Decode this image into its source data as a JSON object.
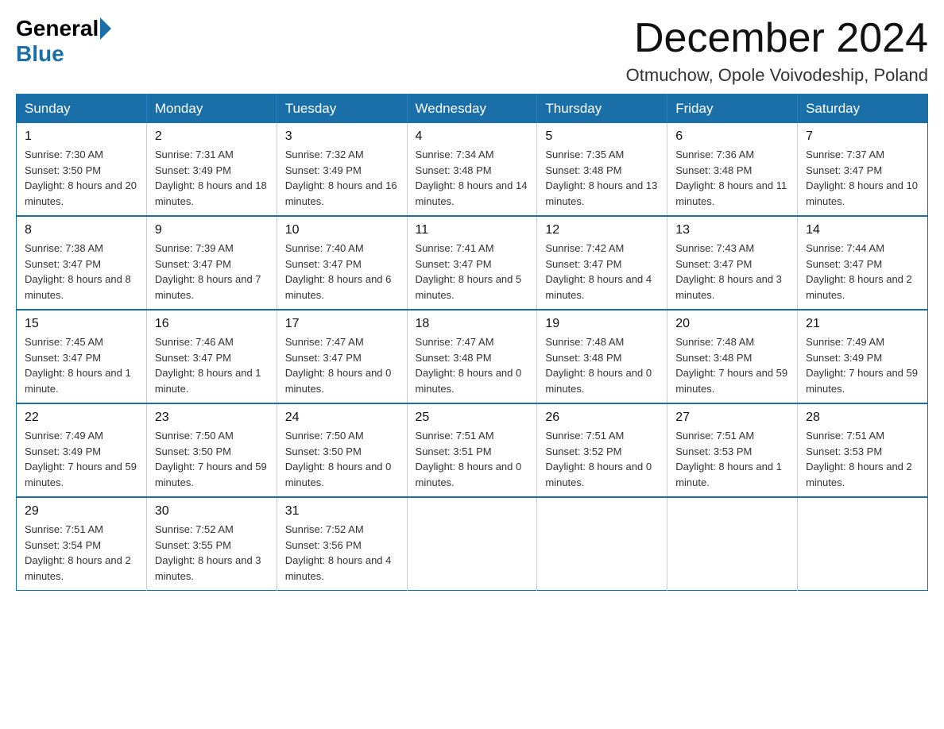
{
  "logo": {
    "general": "General",
    "blue": "Blue"
  },
  "title": "December 2024",
  "location": "Otmuchow, Opole Voivodeship, Poland",
  "days_of_week": [
    "Sunday",
    "Monday",
    "Tuesday",
    "Wednesday",
    "Thursday",
    "Friday",
    "Saturday"
  ],
  "weeks": [
    [
      {
        "day": "1",
        "sunrise": "7:30 AM",
        "sunset": "3:50 PM",
        "daylight": "8 hours and 20 minutes."
      },
      {
        "day": "2",
        "sunrise": "7:31 AM",
        "sunset": "3:49 PM",
        "daylight": "8 hours and 18 minutes."
      },
      {
        "day": "3",
        "sunrise": "7:32 AM",
        "sunset": "3:49 PM",
        "daylight": "8 hours and 16 minutes."
      },
      {
        "day": "4",
        "sunrise": "7:34 AM",
        "sunset": "3:48 PM",
        "daylight": "8 hours and 14 minutes."
      },
      {
        "day": "5",
        "sunrise": "7:35 AM",
        "sunset": "3:48 PM",
        "daylight": "8 hours and 13 minutes."
      },
      {
        "day": "6",
        "sunrise": "7:36 AM",
        "sunset": "3:48 PM",
        "daylight": "8 hours and 11 minutes."
      },
      {
        "day": "7",
        "sunrise": "7:37 AM",
        "sunset": "3:47 PM",
        "daylight": "8 hours and 10 minutes."
      }
    ],
    [
      {
        "day": "8",
        "sunrise": "7:38 AM",
        "sunset": "3:47 PM",
        "daylight": "8 hours and 8 minutes."
      },
      {
        "day": "9",
        "sunrise": "7:39 AM",
        "sunset": "3:47 PM",
        "daylight": "8 hours and 7 minutes."
      },
      {
        "day": "10",
        "sunrise": "7:40 AM",
        "sunset": "3:47 PM",
        "daylight": "8 hours and 6 minutes."
      },
      {
        "day": "11",
        "sunrise": "7:41 AM",
        "sunset": "3:47 PM",
        "daylight": "8 hours and 5 minutes."
      },
      {
        "day": "12",
        "sunrise": "7:42 AM",
        "sunset": "3:47 PM",
        "daylight": "8 hours and 4 minutes."
      },
      {
        "day": "13",
        "sunrise": "7:43 AM",
        "sunset": "3:47 PM",
        "daylight": "8 hours and 3 minutes."
      },
      {
        "day": "14",
        "sunrise": "7:44 AM",
        "sunset": "3:47 PM",
        "daylight": "8 hours and 2 minutes."
      }
    ],
    [
      {
        "day": "15",
        "sunrise": "7:45 AM",
        "sunset": "3:47 PM",
        "daylight": "8 hours and 1 minute."
      },
      {
        "day": "16",
        "sunrise": "7:46 AM",
        "sunset": "3:47 PM",
        "daylight": "8 hours and 1 minute."
      },
      {
        "day": "17",
        "sunrise": "7:47 AM",
        "sunset": "3:47 PM",
        "daylight": "8 hours and 0 minutes."
      },
      {
        "day": "18",
        "sunrise": "7:47 AM",
        "sunset": "3:48 PM",
        "daylight": "8 hours and 0 minutes."
      },
      {
        "day": "19",
        "sunrise": "7:48 AM",
        "sunset": "3:48 PM",
        "daylight": "8 hours and 0 minutes."
      },
      {
        "day": "20",
        "sunrise": "7:48 AM",
        "sunset": "3:48 PM",
        "daylight": "7 hours and 59 minutes."
      },
      {
        "day": "21",
        "sunrise": "7:49 AM",
        "sunset": "3:49 PM",
        "daylight": "7 hours and 59 minutes."
      }
    ],
    [
      {
        "day": "22",
        "sunrise": "7:49 AM",
        "sunset": "3:49 PM",
        "daylight": "7 hours and 59 minutes."
      },
      {
        "day": "23",
        "sunrise": "7:50 AM",
        "sunset": "3:50 PM",
        "daylight": "7 hours and 59 minutes."
      },
      {
        "day": "24",
        "sunrise": "7:50 AM",
        "sunset": "3:50 PM",
        "daylight": "8 hours and 0 minutes."
      },
      {
        "day": "25",
        "sunrise": "7:51 AM",
        "sunset": "3:51 PM",
        "daylight": "8 hours and 0 minutes."
      },
      {
        "day": "26",
        "sunrise": "7:51 AM",
        "sunset": "3:52 PM",
        "daylight": "8 hours and 0 minutes."
      },
      {
        "day": "27",
        "sunrise": "7:51 AM",
        "sunset": "3:53 PM",
        "daylight": "8 hours and 1 minute."
      },
      {
        "day": "28",
        "sunrise": "7:51 AM",
        "sunset": "3:53 PM",
        "daylight": "8 hours and 2 minutes."
      }
    ],
    [
      {
        "day": "29",
        "sunrise": "7:51 AM",
        "sunset": "3:54 PM",
        "daylight": "8 hours and 2 minutes."
      },
      {
        "day": "30",
        "sunrise": "7:52 AM",
        "sunset": "3:55 PM",
        "daylight": "8 hours and 3 minutes."
      },
      {
        "day": "31",
        "sunrise": "7:52 AM",
        "sunset": "3:56 PM",
        "daylight": "8 hours and 4 minutes."
      },
      null,
      null,
      null,
      null
    ]
  ]
}
